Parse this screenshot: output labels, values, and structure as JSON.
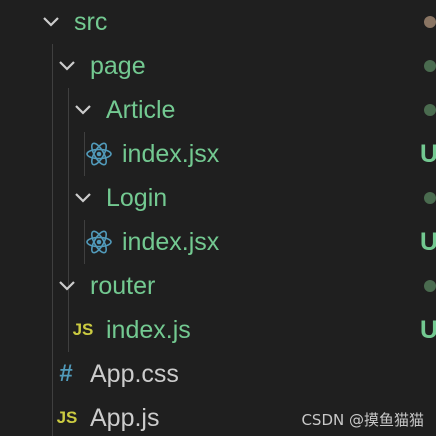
{
  "tree": {
    "items": [
      {
        "label": "src",
        "type": "folder",
        "expanded": true,
        "status_dot": "brown"
      },
      {
        "label": "page",
        "type": "folder",
        "expanded": true,
        "status_dot": "green"
      },
      {
        "label": "Article",
        "type": "folder",
        "expanded": true,
        "status_dot": "green"
      },
      {
        "label": "index.jsx",
        "type": "file",
        "icon": "react-icon",
        "status": "U"
      },
      {
        "label": "Login",
        "type": "folder",
        "expanded": true,
        "status_dot": "green"
      },
      {
        "label": "index.jsx",
        "type": "file",
        "icon": "react-icon",
        "status": "U"
      },
      {
        "label": "router",
        "type": "folder",
        "expanded": true,
        "status_dot": "green"
      },
      {
        "label": "index.js",
        "type": "file",
        "icon": "js-icon",
        "status": "U"
      },
      {
        "label": "App.css",
        "type": "file",
        "icon": "css-icon"
      },
      {
        "label": "App.js",
        "type": "file",
        "icon": "js-icon"
      }
    ]
  },
  "icons": {
    "js_glyph": "JS",
    "css_glyph": "#"
  },
  "watermark": "CSDN @摸鱼猫猫",
  "colors": {
    "background": "#1f1f1f",
    "untracked_green": "#73c991",
    "folder_text": "#73c991",
    "file_text": "#cccccc",
    "react_icon": "#519aba",
    "js_icon": "#cbcb41",
    "css_icon": "#519aba",
    "dot_brown": "#8a7563",
    "dot_green": "#4a6b4f"
  }
}
